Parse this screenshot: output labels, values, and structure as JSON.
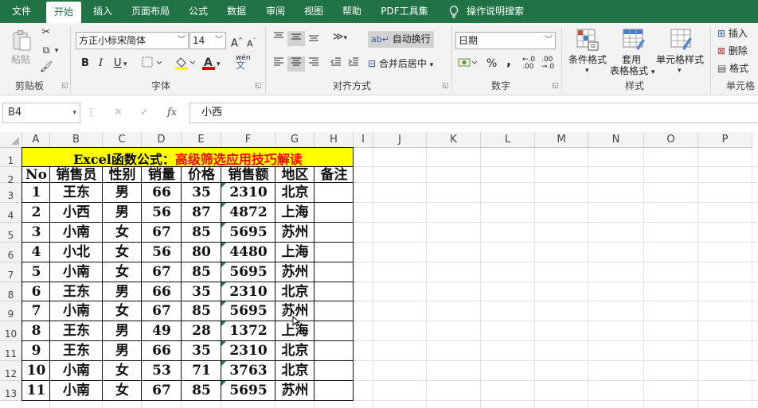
{
  "menu": {
    "tabs": [
      {
        "label": "文件",
        "active": false
      },
      {
        "label": "开始",
        "active": true
      },
      {
        "label": "插入",
        "active": false
      },
      {
        "label": "页面布局",
        "active": false
      },
      {
        "label": "公式",
        "active": false
      },
      {
        "label": "数据",
        "active": false
      },
      {
        "label": "审阅",
        "active": false
      },
      {
        "label": "视图",
        "active": false
      },
      {
        "label": "帮助",
        "active": false
      },
      {
        "label": "PDF工具集",
        "active": false
      },
      {
        "label": "操作说明搜索",
        "active": false
      }
    ]
  },
  "ribbon": {
    "clipboard": {
      "paste_label": "粘贴",
      "group_label": "剪贴板"
    },
    "font": {
      "font_name": "方正小标宋简体",
      "font_size": "14",
      "bold": "B",
      "italic": "I",
      "underline": "U",
      "font_color_glyph": "A",
      "phonetic_glyph": "wén",
      "grow_glyph": "A",
      "shrink_glyph": "A",
      "group_label": "字体"
    },
    "alignment": {
      "wrap_label": "自动换行",
      "merge_label": "合并后居中",
      "group_label": "对齐方式"
    },
    "number": {
      "format": "日期",
      "percent": "%",
      "comma": ",",
      "inc_decimal": ".00",
      "dec_decimal": ".0",
      "group_label": "数字"
    },
    "styles": {
      "cond_format": "条件格式",
      "table_format_1": "套用",
      "table_format_2": "表格格式",
      "cell_styles": "单元格样式",
      "group_label": "样式"
    },
    "cells": {
      "insert": "插入",
      "delete": "删除",
      "format": "格式",
      "group_label": "单元格"
    }
  },
  "formula_bar": {
    "name_box": "B4",
    "cancel": "✕",
    "enter": "✓",
    "fx": "fx",
    "content": "小西"
  },
  "columns": [
    "A",
    "B",
    "C",
    "D",
    "E",
    "F",
    "G",
    "H",
    "I",
    "J",
    "K",
    "L",
    "M",
    "N",
    "O",
    "P"
  ],
  "rows": [
    "1",
    "2",
    "3",
    "4",
    "5",
    "6",
    "7",
    "8",
    "9",
    "10",
    "11",
    "12",
    "13"
  ],
  "sheet": {
    "title_prefix": "Excel函数公式：",
    "title_suffix": "高级筛选应用技巧解读",
    "title_prefix_color": "#000000",
    "title_suffix_color": "#ff0000",
    "title_bg": "#ffff00",
    "headers": [
      "No",
      "销售员",
      "性别",
      "销量",
      "价格",
      "销售额",
      "地区",
      "备注"
    ],
    "records": [
      [
        "1",
        "王东",
        "男",
        "66",
        "35",
        "2310",
        "北京",
        ""
      ],
      [
        "2",
        "小西",
        "男",
        "56",
        "87",
        "4872",
        "上海",
        ""
      ],
      [
        "3",
        "小南",
        "女",
        "67",
        "85",
        "5695",
        "苏州",
        ""
      ],
      [
        "4",
        "小北",
        "女",
        "56",
        "80",
        "4480",
        "上海",
        ""
      ],
      [
        "5",
        "小南",
        "女",
        "67",
        "85",
        "5695",
        "苏州",
        ""
      ],
      [
        "6",
        "王东",
        "男",
        "66",
        "35",
        "2310",
        "北京",
        ""
      ],
      [
        "7",
        "小南",
        "女",
        "67",
        "85",
        "5695",
        "苏州",
        ""
      ],
      [
        "8",
        "王东",
        "男",
        "49",
        "28",
        "1372",
        "上海",
        ""
      ],
      [
        "9",
        "王东",
        "男",
        "66",
        "35",
        "2310",
        "北京",
        ""
      ],
      [
        "10",
        "小南",
        "女",
        "53",
        "71",
        "3763",
        "北京",
        ""
      ],
      [
        "11",
        "小南",
        "女",
        "67",
        "85",
        "5695",
        "苏州",
        ""
      ]
    ]
  }
}
